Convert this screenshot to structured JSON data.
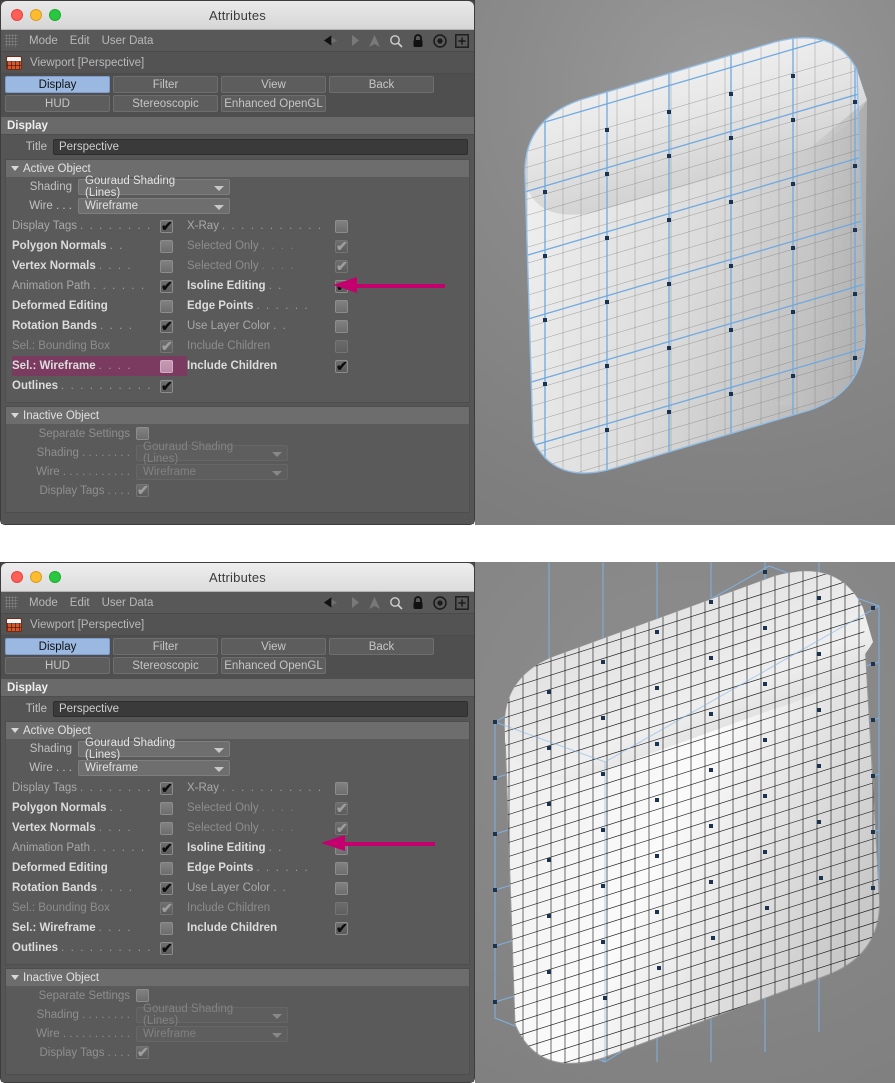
{
  "window": {
    "title": "Attributes",
    "traffic_lights": [
      "close",
      "minimize",
      "zoom"
    ],
    "menu": [
      "Mode",
      "Edit",
      "User Data"
    ],
    "toolbar_icons": [
      "back-arrow-icon",
      "forward-arrow-icon",
      "up-arrow-icon",
      "search-icon",
      "lock-icon",
      "target-icon",
      "plus-icon"
    ],
    "object_header": "Viewport [Perspective]",
    "object_icon": "viewport-brick-icon"
  },
  "tabs": {
    "row1": [
      {
        "label": "Display",
        "active": true
      },
      {
        "label": "Filter",
        "active": false
      },
      {
        "label": "View",
        "active": false
      },
      {
        "label": "Back",
        "active": false
      }
    ],
    "row2": [
      {
        "label": "HUD",
        "active": false
      },
      {
        "label": "Stereoscopic",
        "active": false
      },
      {
        "label": "Enhanced OpenGL",
        "active": false
      }
    ]
  },
  "display": {
    "section_title": "Display",
    "title_label": "Title",
    "title_value": "Perspective"
  },
  "active_object": {
    "header": "Active Object",
    "shading_label": "Shading",
    "shading_value": "Gouraud Shading (Lines)",
    "wire_label": "Wire . . .",
    "wire_value": "Wireframe"
  },
  "inactive_object": {
    "header": "Inactive Object",
    "separate_settings_label": "Separate Settings",
    "separate_settings_checked": false,
    "shading_label": "Shading . . . . . . . .",
    "shading_value": "Gouraud Shading (Lines)",
    "wire_label": "Wire . . . . . . . . . . .",
    "wire_value": "Wireframe",
    "display_tags_label": "Display Tags . . . .",
    "display_tags_checked": true
  },
  "checkboxes_top": {
    "left": [
      {
        "label": "Display Tags",
        "dots": ". . . . . . . .",
        "checked": true,
        "style": "soft"
      },
      {
        "label": "Polygon Normals",
        "dots": ". .",
        "checked": false,
        "style": "bold"
      },
      {
        "label": "Vertex Normals",
        "dots": ". . . .",
        "checked": false,
        "style": "bold"
      },
      {
        "label": "Animation Path",
        "dots": ". . . . . .",
        "checked": true,
        "style": "soft"
      },
      {
        "label": "Deformed Editing",
        "dots": "",
        "checked": false,
        "style": "bold"
      },
      {
        "label": "Rotation Bands",
        "dots": ". . . .",
        "checked": true,
        "style": "bold"
      },
      {
        "label": "Sel.: Bounding Box",
        "dots": "",
        "checked": true,
        "style": "faint"
      },
      {
        "label": "Sel.: Wireframe",
        "dots": ". . . .",
        "checked": false,
        "style": "bold",
        "highlight": true
      },
      {
        "label": "Outlines",
        "dots": ". . . . . . . . . .",
        "checked": true,
        "style": "bold"
      }
    ],
    "right": [
      {
        "label": "X-Ray",
        "dots": ". . . . . . . . . . .",
        "checked": false,
        "style": "soft"
      },
      {
        "label": "Selected Only",
        "dots": ". . . .",
        "checked": true,
        "style": "faint"
      },
      {
        "label": "Selected Only",
        "dots": ". . . .",
        "checked": true,
        "style": "faint"
      },
      {
        "label": "Isoline Editing",
        "dots": ". .",
        "checked": true,
        "style": "bold"
      },
      {
        "label": "Edge Points",
        "dots": ". . . . . .",
        "checked": false,
        "style": "bold"
      },
      {
        "label": "Use Layer Color",
        "dots": ". .",
        "checked": false,
        "style": "soft"
      },
      {
        "label": "Include Children",
        "dots": "",
        "checked": false,
        "style": "faint"
      },
      {
        "label": "Include Children",
        "dots": "",
        "checked": true,
        "style": "bold"
      }
    ]
  },
  "checkboxes_bottom": {
    "left": [
      {
        "label": "Display Tags",
        "dots": ". . . . . . . .",
        "checked": true,
        "style": "soft"
      },
      {
        "label": "Polygon Normals",
        "dots": ". .",
        "checked": false,
        "style": "bold"
      },
      {
        "label": "Vertex Normals",
        "dots": ". . . .",
        "checked": false,
        "style": "bold"
      },
      {
        "label": "Animation Path",
        "dots": ". . . . . .",
        "checked": true,
        "style": "soft"
      },
      {
        "label": "Deformed Editing",
        "dots": "",
        "checked": false,
        "style": "bold"
      },
      {
        "label": "Rotation Bands",
        "dots": ". . . .",
        "checked": true,
        "style": "bold"
      },
      {
        "label": "Sel.: Bounding Box",
        "dots": "",
        "checked": true,
        "style": "faint"
      },
      {
        "label": "Sel.: Wireframe",
        "dots": ". . . .",
        "checked": false,
        "style": "bold"
      },
      {
        "label": "Outlines",
        "dots": ". . . . . . . . . .",
        "checked": true,
        "style": "bold"
      }
    ],
    "right": [
      {
        "label": "X-Ray",
        "dots": ". . . . . . . . . . .",
        "checked": false,
        "style": "soft"
      },
      {
        "label": "Selected Only",
        "dots": ". . . .",
        "checked": true,
        "style": "faint"
      },
      {
        "label": "Selected Only",
        "dots": ". . . .",
        "checked": true,
        "style": "faint"
      },
      {
        "label": "Isoline Editing",
        "dots": ". .",
        "checked": false,
        "style": "bold"
      },
      {
        "label": "Edge Points",
        "dots": ". . . . . .",
        "checked": false,
        "style": "bold"
      },
      {
        "label": "Use Layer Color",
        "dots": ". .",
        "checked": false,
        "style": "soft"
      },
      {
        "label": "Include Children",
        "dots": "",
        "checked": false,
        "style": "faint"
      },
      {
        "label": "Include Children",
        "dots": "",
        "checked": true,
        "style": "bold"
      }
    ]
  },
  "annotations": {
    "arrow_color": "#c4006e",
    "arrow_target_top": "Isoline Editing checkbox (checked)",
    "arrow_target_bottom": "Isoline Editing checkbox (unchecked)"
  },
  "viewports": {
    "top": {
      "object": "rounded-cube",
      "wire_color": "#6da8e0",
      "point_color": "#1c3350",
      "description": "Subdivision cube with isoline editing on — sparse blue cage lines"
    },
    "bottom": {
      "object": "rounded-cube",
      "wire_color": "#111111",
      "cage_color": "#7fb4e8",
      "point_color": "#1c3350",
      "description": "Subdivision cube with isoline editing off — dense black wireframe plus blue cage"
    }
  }
}
